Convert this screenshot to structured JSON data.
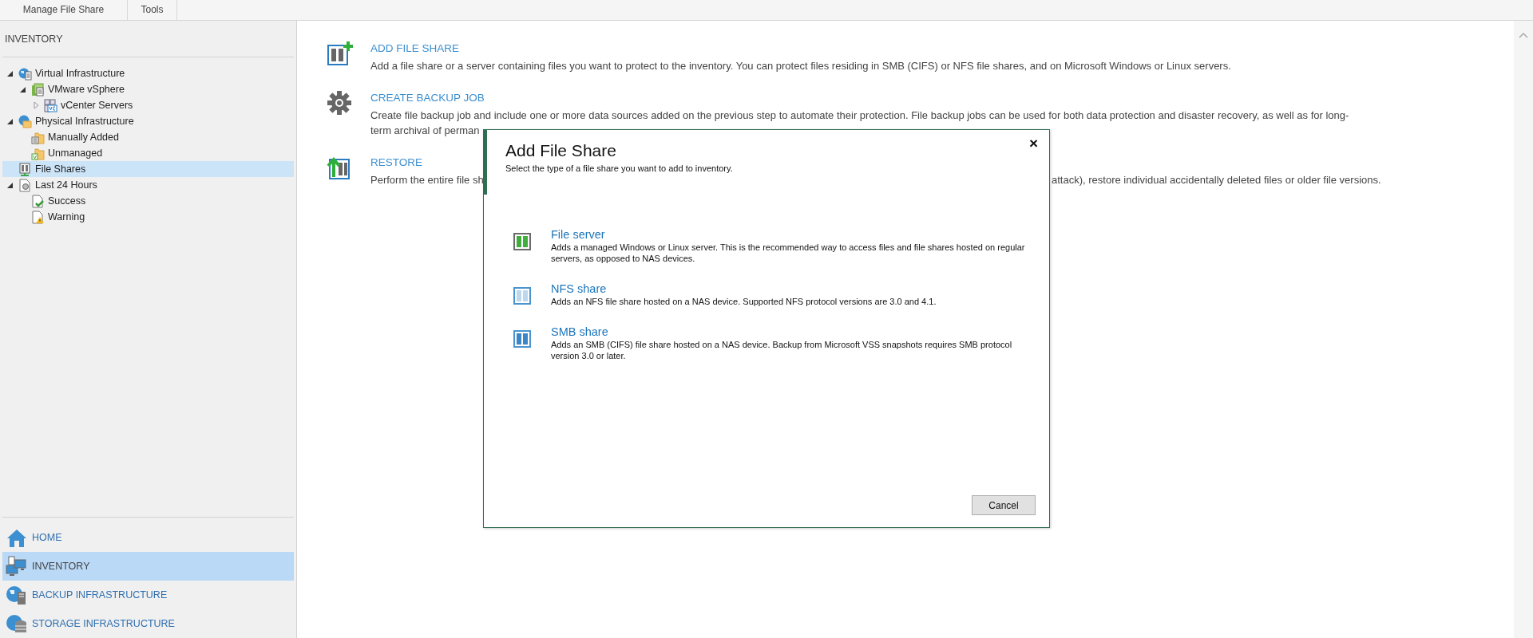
{
  "ribbon": {
    "groups": [
      "Manage File Share",
      "Tools"
    ]
  },
  "sidebar": {
    "header": "INVENTORY",
    "tree": [
      {
        "label": "Virtual Infrastructure",
        "kind": "globe",
        "expanded": true,
        "selected": false,
        "children": [
          {
            "label": "VMware vSphere",
            "kind": "cluster",
            "expanded": true,
            "selected": false,
            "children": [
              {
                "label": "vCenter Servers",
                "kind": "servers",
                "expanded": false,
                "selected": false
              }
            ]
          }
        ]
      },
      {
        "label": "Physical Infrastructure",
        "kind": "globe-folder",
        "expanded": true,
        "selected": false,
        "children": [
          {
            "label": "Manually Added",
            "kind": "folder",
            "selected": false
          },
          {
            "label": "Unmanaged",
            "kind": "folder-check",
            "selected": false
          }
        ]
      },
      {
        "label": "File Shares",
        "kind": "shares",
        "selected": true
      },
      {
        "label": "Last 24 Hours",
        "kind": "jobs",
        "expanded": true,
        "selected": false,
        "children": [
          {
            "label": "Success",
            "kind": "success",
            "selected": false
          },
          {
            "label": "Warning",
            "kind": "warning",
            "selected": false
          }
        ]
      }
    ],
    "nav": [
      {
        "label": "HOME",
        "kind": "home",
        "selected": false
      },
      {
        "label": "INVENTORY",
        "kind": "inventory",
        "selected": true
      },
      {
        "label": "BACKUP INFRASTRUCTURE",
        "kind": "backup",
        "selected": false
      },
      {
        "label": "STORAGE INFRASTRUCTURE",
        "kind": "storage",
        "selected": false
      }
    ]
  },
  "actions": [
    {
      "kind": "add",
      "title": "ADD FILE SHARE",
      "lines": [
        [
          "Add a file share or a server containing files you want to protect to the inventory. You can protect files residing in SMB (CIFS) or NFS file shares, and on Microsoft Windows or Linux servers."
        ]
      ]
    },
    {
      "kind": "job",
      "title": "CREATE BACKUP JOB",
      "lines": [
        [
          "Create file backup job and include one or more data sources added on the previous step to automate their protection. File backup jobs can be used for both data protection and disaster recovery, as well as for long-"
        ],
        [
          "term archival of perman"
        ]
      ]
    },
    {
      "kind": "restore",
      "title": "RESTORE",
      "lines": [
        [
          "Perform the entire file sh",
          "attack), restore individual accidentally deleted files or older file versions."
        ]
      ]
    }
  ],
  "dialog": {
    "title": "Add File Share",
    "subtitle": "Select the type of a file share you want to add to inventory.",
    "close": "×",
    "options": [
      {
        "kind": "server",
        "title": "File server",
        "description": "Adds a managed Windows or Linux server. This is the recommended way to access files and file shares hosted on regular servers, as opposed to NAS devices."
      },
      {
        "kind": "nfs",
        "title": "NFS share",
        "description": "Adds an NFS file share hosted on a NAS device. Supported NFS protocol versions are 3.0 and 4.1."
      },
      {
        "kind": "smb",
        "title": "SMB share",
        "description": "Adds an SMB (CIFS) file share hosted on a NAS device. Backup from Microsoft VSS snapshots requires SMB protocol version 3.0 or later."
      }
    ],
    "buttons": [
      "Cancel"
    ]
  }
}
